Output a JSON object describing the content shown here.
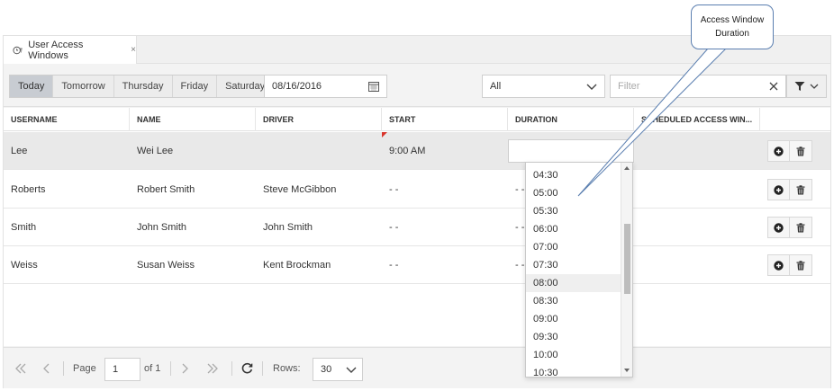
{
  "callout": {
    "line1": "Access Window",
    "line2": "Duration"
  },
  "tab": {
    "label": "User Access Windows",
    "close": "×"
  },
  "toolbar": {
    "days": [
      "Today",
      "Tomorrow",
      "Thursday",
      "Friday",
      "Saturday"
    ],
    "active_day": "Today",
    "date_value": "08/16/2016",
    "select_value": "All",
    "filter_placeholder": "Filter"
  },
  "grid": {
    "columns": [
      "USERNAME",
      "NAME",
      "DRIVER",
      "START",
      "DURATION",
      "SCHEDULED ACCESS WIN..."
    ],
    "rows": [
      {
        "username": "Lee",
        "name": "Wei Lee",
        "driver": "",
        "start": "9:00 AM",
        "duration": ""
      },
      {
        "username": "Roberts",
        "name": "Robert Smith",
        "driver": "Steve McGibbon",
        "start": "- -",
        "duration": "- -"
      },
      {
        "username": "Smith",
        "name": "John Smith",
        "driver": "John Smith",
        "start": "- -",
        "duration": "- -"
      },
      {
        "username": "Weiss",
        "name": "Susan Weiss",
        "driver": "Kent Brockman",
        "start": "- -",
        "duration": "- -"
      }
    ]
  },
  "pager": {
    "page_label": "Page",
    "page_value": "1",
    "of_label": "of 1",
    "rows_label": "Rows:",
    "rows_value": "30"
  },
  "duration_options": [
    "04:30",
    "05:00",
    "05:30",
    "06:00",
    "07:00",
    "07:30",
    "08:00",
    "08:30",
    "09:00",
    "09:30",
    "10:00",
    "10:30"
  ],
  "duration_highlighted": "08:00",
  "colors": {
    "accent_red": "#d9342b",
    "selected_row": "#e9e9e9",
    "callout_border": "#5b7fb0"
  }
}
